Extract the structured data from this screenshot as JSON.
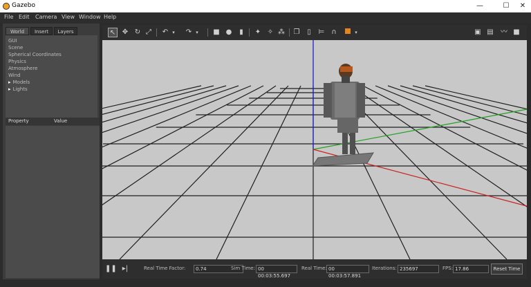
{
  "window": {
    "title": "Gazebo",
    "minimize_icon": "minimize-icon",
    "maximize_icon": "maximize-icon",
    "close_icon": "close-icon"
  },
  "menu": [
    "File",
    "Edit",
    "Camera",
    "View",
    "Window",
    "Help"
  ],
  "left_panel": {
    "tabs": [
      "World",
      "Insert",
      "Layers"
    ],
    "tree_rows": [
      "GUI",
      "Scene",
      "Spherical Coordinates",
      "Physics",
      "Atmosphere",
      "Wind",
      "Models",
      "Lights"
    ],
    "properties": {
      "col1": "Property",
      "col2": "Value"
    }
  },
  "toolbar": {
    "icons": [
      "select-mode-icon",
      "translate-mode-icon",
      "rotate-mode-icon",
      "scale-mode-icon",
      "undo-icon",
      "redo-icon",
      "box-icon",
      "sphere-icon",
      "cylinder-icon",
      "point-light-icon",
      "spot-light-icon",
      "directional-light-icon",
      "copy-icon",
      "paste-icon",
      "align-icon",
      "snap-icon",
      "view-angle-icon",
      "screenshot-icon",
      "log-icon",
      "plot-icon",
      "record-icon"
    ]
  },
  "timebar": {
    "rtf_label": "Real Time Factor:",
    "rtf": "0.74",
    "sim_label": "Sim Time:",
    "sim_time": "00 00:03:55.697",
    "real_label": "Real Time:",
    "real_time": "00 00:03:57.891",
    "iter_label": "Iterations:",
    "iterations": "235697",
    "fps_label": "FPS:",
    "fps": "17.86",
    "reset_label": "Reset Time"
  },
  "colors": {
    "scene_bg": "#c8c8c8",
    "grid": "#202020",
    "axis_x": "#cc2020",
    "axis_y": "#20a020",
    "axis_z": "#2020cc"
  }
}
